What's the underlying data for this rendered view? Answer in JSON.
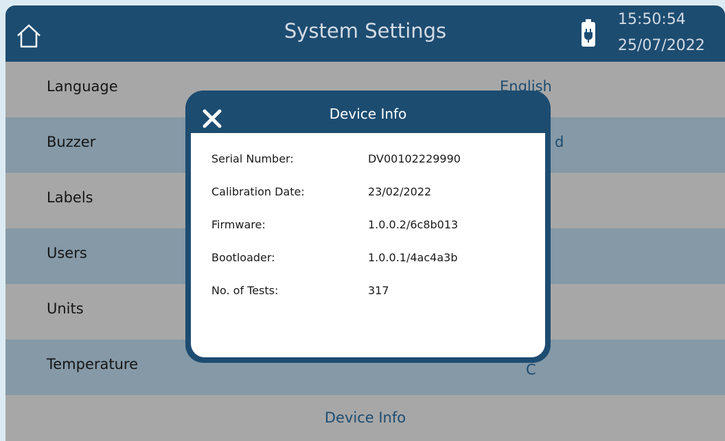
{
  "header": {
    "title": "System Settings",
    "time": "15:50:54",
    "date": "25/07/2022",
    "home_icon": "home-icon",
    "battery_icon": "battery-charging-icon"
  },
  "settings": {
    "rows": [
      {
        "label": "Language",
        "value": "English"
      },
      {
        "label": "Buzzer",
        "value": "d"
      },
      {
        "label": "Labels",
        "value": ""
      },
      {
        "label": "Users",
        "value": ""
      },
      {
        "label": "Units",
        "value": ""
      },
      {
        "label": "Temperature",
        "value": "C"
      }
    ],
    "footer_button": "Device Info"
  },
  "modal": {
    "title": "Device Info",
    "close_icon": "close-icon",
    "fields": [
      {
        "label": "Serial Number:",
        "value": "DV00102229990"
      },
      {
        "label": "Calibration Date:",
        "value": "23/02/2022"
      },
      {
        "label": "Firmware:",
        "value": "1.0.0.2/6c8b013"
      },
      {
        "label": "Bootloader:",
        "value": "1.0.0.1/4ac4a3b"
      },
      {
        "label": "No. of Tests:",
        "value": "317"
      }
    ]
  },
  "colors": {
    "header": "#1d4c71",
    "row_light": "#a7a7a7",
    "row_dark": "#8599a7",
    "accent_text": "#1d4c71"
  }
}
